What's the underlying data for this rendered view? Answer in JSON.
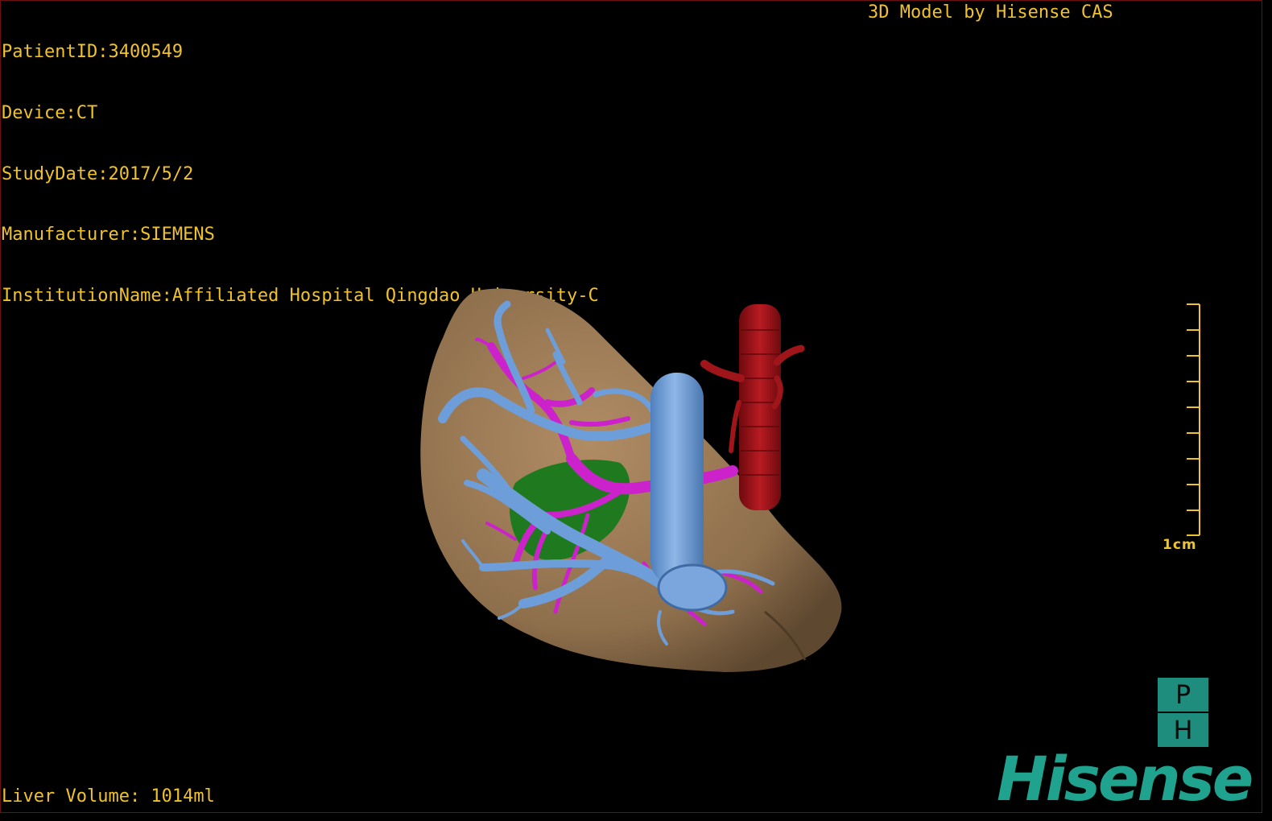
{
  "patient_info": {
    "patient_id": "PatientID:3400549",
    "device": "Device:CT",
    "study_date": "StudyDate:2017/5/2",
    "manufacturer": "Manufacturer:SIEMENS",
    "institution": "InstitutionName:Affiliated Hospital Qingdao University-C"
  },
  "credit": "3D Model by Hisense CAS",
  "liver_volume": "Liver Volume: 1014ml",
  "scale_bar": {
    "label": "1cm"
  },
  "logo": {
    "top_letter": "P",
    "bottom_letter": "H",
    "brand": "Hisense"
  },
  "colors": {
    "text": "#f0c22b",
    "liver": "#9b7a55",
    "hepatic_vein": "#6e9ed9",
    "portal_vein": "#cc22cc",
    "aorta": "#a0151a",
    "lesion": "#1f7a1f",
    "brand": "#1fa28e"
  }
}
